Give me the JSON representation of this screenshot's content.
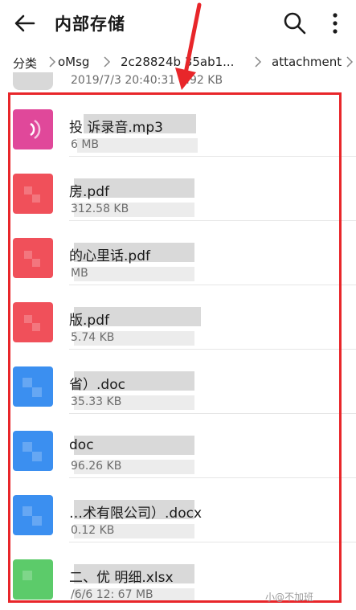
{
  "header": {
    "title": "内部存储"
  },
  "breadcrumb": [
    "分类",
    "oMsg",
    "2c28824b  35ab1...",
    "attachment"
  ],
  "previous_item": {
    "meta": "2019/7/3 20:40:31   3.92 KB"
  },
  "files": [
    {
      "name": "   投          诉录音.mp3",
      "meta": "      6 MB",
      "icon_color": "#e0489a",
      "type": "audio"
    },
    {
      "name": "           房.pdf",
      "meta": "       312.58 KB",
      "icon_color": "#f0505a",
      "type": "pdf"
    },
    {
      "name": "           的心里话.pdf",
      "meta": "           MB",
      "icon_color": "#f0505a",
      "type": "pdf"
    },
    {
      "name": "           版.pdf",
      "meta": "       5.74 KB",
      "icon_color": "#f0505a",
      "type": "pdf"
    },
    {
      "name": "           省）.doc",
      "meta": "       35.33 KB",
      "icon_color": "#3b8ff0",
      "type": "doc"
    },
    {
      "name": "           doc",
      "meta": "       96.26 KB",
      "icon_color": "#3b8ff0",
      "type": "doc"
    },
    {
      "name": "          …术有限公司）.docx",
      "meta": "       0.12 KB",
      "icon_color": "#3b8ff0",
      "type": "doc"
    },
    {
      "name": "   二、优      明细.xlsx",
      "meta": "   /6/6 12:    67 MB",
      "icon_color": "#5ccb6a",
      "type": "xls"
    }
  ],
  "watermark": "小@不加班",
  "colors": {
    "highlight": "#e8262a",
    "pdf": "#f0505a",
    "doc": "#3b8ff0",
    "xls": "#5ccb6a",
    "audio": "#e0489a"
  },
  "icons": [
    "back-arrow-icon",
    "search-icon",
    "more-vertical-icon",
    "chevron-right-icon"
  ]
}
